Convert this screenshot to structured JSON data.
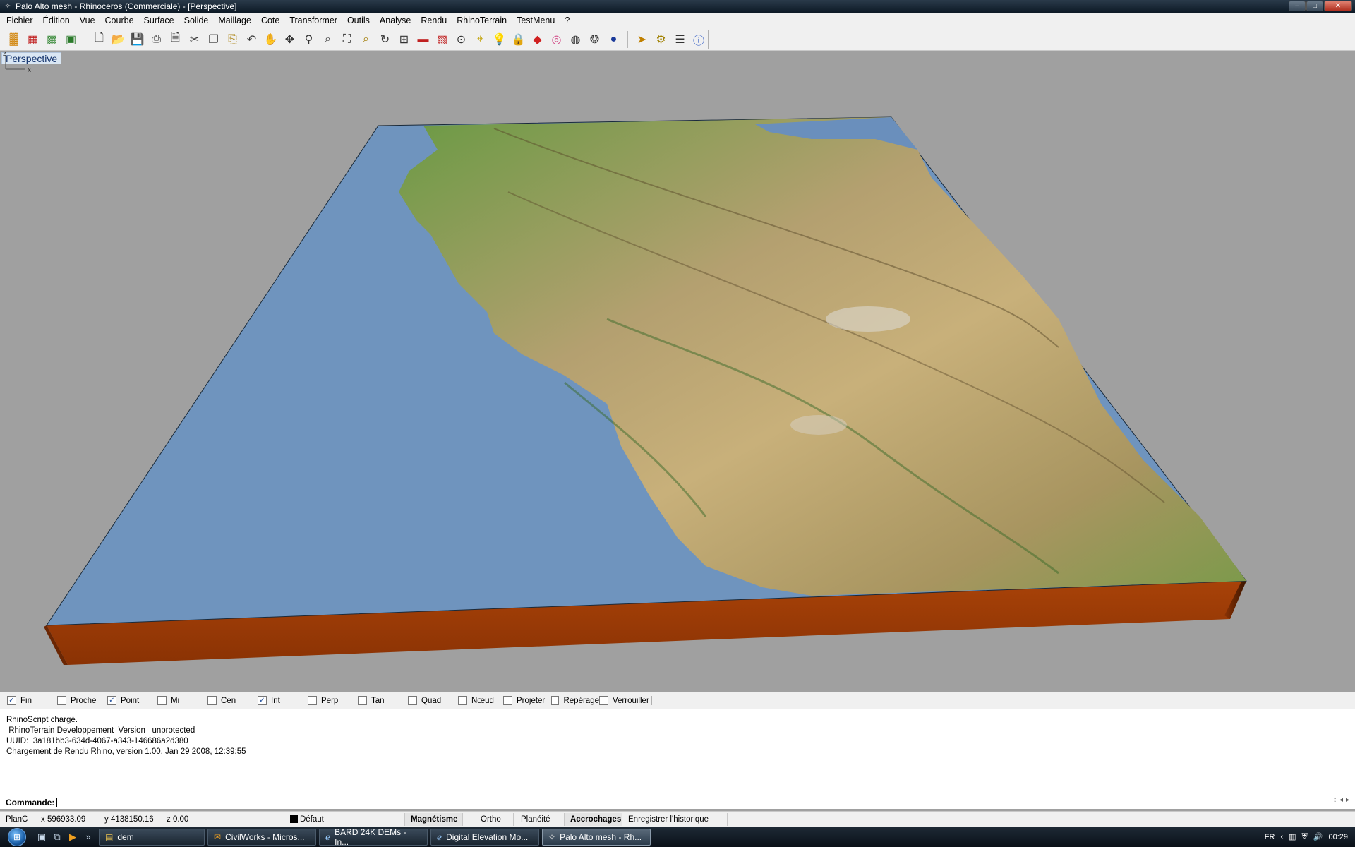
{
  "window": {
    "title": "Palo Alto mesh - Rhinoceros (Commerciale) - [Perspective]",
    "controls": [
      "minimize-icon",
      "maximize-icon",
      "close-icon"
    ]
  },
  "menu": [
    "Fichier",
    "Édition",
    "Vue",
    "Courbe",
    "Surface",
    "Solide",
    "Maillage",
    "Cote",
    "Transformer",
    "Outils",
    "Analyse",
    "Rendu",
    "RhinoTerrain",
    "TestMenu",
    "?"
  ],
  "toolbar": {
    "icons": [
      "terrain-chart-icon",
      "color-map-icon",
      "raster-icon",
      "jpg-export-icon",
      "new-file-icon",
      "open-file-icon",
      "save-icon",
      "print-icon",
      "import-icon",
      "cut-icon",
      "copy-icon",
      "paste-icon",
      "undo-icon",
      "pan-hand-icon",
      "rotate-view-icon",
      "zoom-icon",
      "zoom-window-icon",
      "zoom-extents-icon",
      "zoom-selected-icon",
      "rotate-icon",
      "four-viewports-icon",
      "car-icon",
      "grid-icon",
      "snap-icon",
      "object-snap-icon",
      "light-bulb-icon",
      "lock-icon",
      "layer-icon",
      "color-wheel-icon",
      "wireframe-sphere-icon",
      "shaded-sphere-icon",
      "render-sphere-icon",
      "cursor-icon",
      "settings-gear-icon",
      "options-icon",
      "help-icon"
    ]
  },
  "viewport": {
    "label": "Perspective",
    "axis_labels": {
      "z": "z",
      "x": "x"
    },
    "colors": {
      "background": "#a0a0a0",
      "water": "#6f94be",
      "base": "#9a3a05",
      "land_low": "#6a9a44",
      "land_high": "#c8b07a"
    }
  },
  "osnaps": [
    {
      "label": "Fin",
      "checked": true
    },
    {
      "label": "Proche",
      "checked": false
    },
    {
      "label": "Point",
      "checked": true
    },
    {
      "label": "Mi",
      "checked": false
    },
    {
      "label": "Cen",
      "checked": false
    },
    {
      "label": "Int",
      "checked": true
    },
    {
      "label": "Perp",
      "checked": false
    },
    {
      "label": "Tan",
      "checked": false
    },
    {
      "label": "Quad",
      "checked": false
    },
    {
      "label": "Nœud",
      "checked": false
    },
    {
      "label": "Projeter",
      "checked": false
    },
    {
      "label": "Repérage",
      "checked": false
    },
    {
      "label": "Verrouiller",
      "checked": false
    }
  ],
  "history": [
    "RhinoScript chargé.",
    " RhinoTerrain Developpement  Version   unprotected",
    "UUID:  3a181bb3-634d-4067-a343-146686a2d380",
    "Chargement de Rendu Rhino, version 1.00, Jan 29 2008, 12:39:55"
  ],
  "command": {
    "label": "Commande:"
  },
  "status": {
    "cplane": "PlanC",
    "x": "x 596933.09",
    "y": "y 4138150.16",
    "z": "z 0.00",
    "layer": "Défaut",
    "panes": [
      "Magnétisme",
      "Ortho",
      "Planéité",
      "Accrochages",
      "Enregistrer l'historique"
    ]
  },
  "taskbar": {
    "quicklaunch": [
      "show-desktop-icon",
      "switch-windows-icon",
      "media-player-icon",
      "overflow-chevron-icon"
    ],
    "tasks": [
      {
        "label": "dem",
        "icon": "folder-icon",
        "active": false
      },
      {
        "label": "CivilWorks - Micros...",
        "icon": "outlook-icon",
        "active": false
      },
      {
        "label": "BARD 24K DEMs - In...",
        "icon": "ie-icon",
        "active": false
      },
      {
        "label": "Digital Elevation Mo...",
        "icon": "ie-icon",
        "active": false
      },
      {
        "label": "Palo Alto mesh - Rh...",
        "icon": "rhino-icon",
        "active": true
      }
    ],
    "tray": {
      "language": "FR",
      "time": "00:29"
    }
  }
}
